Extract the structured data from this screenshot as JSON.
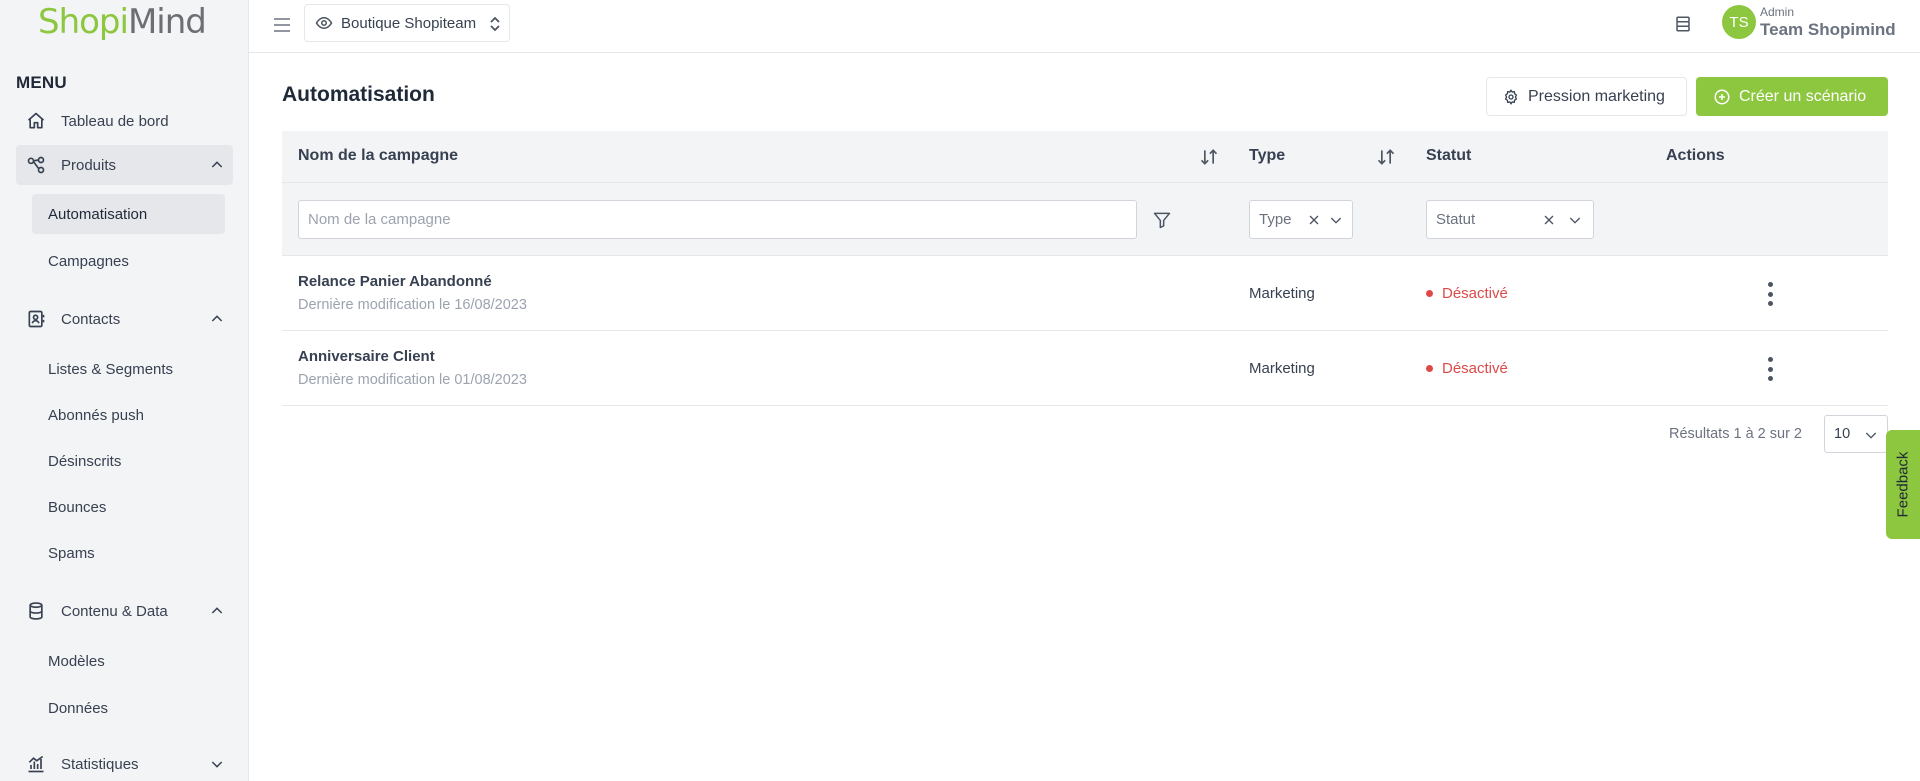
{
  "brand": {
    "logo_part1": "Shopi",
    "logo_part2": "Mind",
    "accent_color": "#8dc63f"
  },
  "sidebar": {
    "menu_label": "MENU",
    "items": [
      {
        "label": "Tableau de bord",
        "icon": "home-icon"
      },
      {
        "label": "Produits",
        "icon": "share-nodes-icon",
        "expanded": true,
        "children": [
          {
            "label": "Automatisation",
            "active": true
          },
          {
            "label": "Campagnes"
          }
        ]
      },
      {
        "label": "Contacts",
        "icon": "contact-book-icon",
        "expanded": true,
        "children": [
          {
            "label": "Listes & Segments"
          },
          {
            "label": "Abonnés push"
          },
          {
            "label": "Désinscrits"
          },
          {
            "label": "Bounces"
          },
          {
            "label": "Spams"
          }
        ]
      },
      {
        "label": "Contenu & Data",
        "icon": "database-icon",
        "expanded": true,
        "children": [
          {
            "label": "Modèles"
          },
          {
            "label": "Données"
          }
        ]
      },
      {
        "label": "Statistiques",
        "icon": "bar-chart-icon",
        "expanded": false
      }
    ]
  },
  "topbar": {
    "shop_name": "Boutique Shopiteam",
    "user_initials": "TS",
    "user_role": "Admin",
    "user_name": "Team Shopimind"
  },
  "main": {
    "title": "Automatisation",
    "btn_pression": "Pression marketing",
    "btn_create": "Créer un scénario",
    "table": {
      "columns": [
        "Nom de la campagne",
        "Type",
        "Statut",
        "Actions"
      ],
      "filter_name_placeholder": "Nom de la campagne",
      "filter_type_value": "Type",
      "filter_status_value": "Statut",
      "rows": [
        {
          "name": "Relance Panier Abandonné",
          "modified": "Dernière modification le 16/08/2023",
          "type": "Marketing",
          "status": "Désactivé"
        },
        {
          "name": "Anniversaire Client",
          "modified": "Dernière modification le 01/08/2023",
          "type": "Marketing",
          "status": "Désactivé"
        }
      ]
    },
    "results_text": "Résultats 1 à 2 sur 2",
    "per_page": "10"
  },
  "feedback_label": "Feedback"
}
